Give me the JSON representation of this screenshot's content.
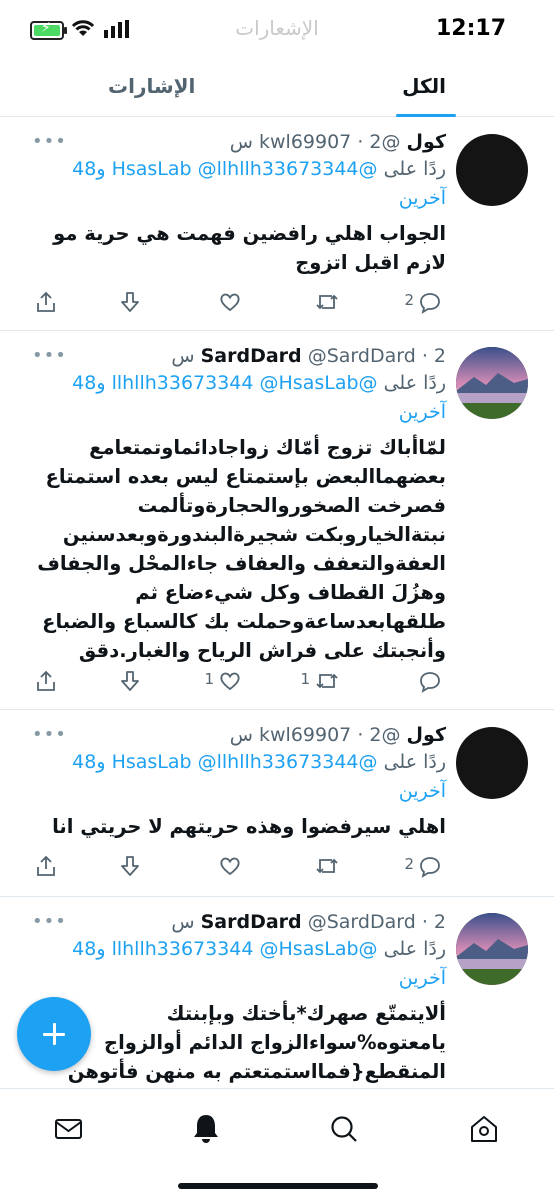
{
  "status": {
    "time": "12:17",
    "faded_title": "الإشعارات"
  },
  "tabs": {
    "all": "الكل",
    "mentions": "الإشارات"
  },
  "tweets": [
    {
      "name": "كول",
      "handle": "@kwl69907",
      "time": "2 س",
      "reply_label": "ردًا على",
      "reply_handles": "@HsasLab @llhllh33673344 و48",
      "reply_more": "آخرين",
      "text": "الجواب اهلي رافضين فهمت هي حرية مو لازم اقبل اتزوج",
      "reply_count": "2",
      "retweet_count": "",
      "like_count": ""
    },
    {
      "name": "SardDard",
      "handle": "@SardDard",
      "time": "2 س",
      "reply_label": "ردًا على",
      "reply_handles": "@llhllh33673344 @HsasLab و48",
      "reply_more": "آخرين",
      "text": "لمّاأباك تزوج أمّاك زواجادائماوتمتعامع بعضهماالبعض بإستمتاع ليس بعده استمتاع فصرخت الصخوروالحجارةوتألمت نبتةالخياروبكت شجيرةالبندورةوبعدسنين العفةوالتعفف والعفاف جاءالمحْل والجفاف وهزُلَ القطاف وكل شيءضاع ثم طلقهابعدساعةوحملت بك كالسباع والضباع وأنجبتك على فراش الرياح والغبار.دقق",
      "reply_count": "",
      "retweet_count": "1",
      "like_count": "1"
    },
    {
      "name": "كول",
      "handle": "@kwl69907",
      "time": "2 س",
      "reply_label": "ردًا على",
      "reply_handles": "@HsasLab @llhllh33673344 و48",
      "reply_more": "آخرين",
      "text": "اهلي سيرفضوا وهذه حريتهم لا حريتي انا",
      "reply_count": "2",
      "retweet_count": "",
      "like_count": ""
    },
    {
      "name": "SardDard",
      "handle": "@SardDard",
      "time": "2 س",
      "reply_label": "ردًا على",
      "reply_handles": "@llhllh33673344 @HsasLab و48",
      "reply_more": "آخرين",
      "text": "ألايتمتّع صهرك*بأختك وبإبنتك يامعتوه%سواءالزواج الدائم أوالزواج المنقطع{فمااستمتعتم به منهن فأتوهن",
      "reply_count": "",
      "retweet_count": "",
      "like_count": ""
    }
  ],
  "icons": {
    "more": "more-icon",
    "share": "share-icon",
    "downvote": "downvote-icon",
    "like": "heart-icon",
    "retweet": "retweet-icon",
    "reply": "reply-icon",
    "compose": "plus-icon",
    "nav": [
      "mail-icon",
      "bell-icon",
      "search-icon",
      "home-icon"
    ]
  },
  "colors": {
    "accent": "#1da1f2",
    "text": "#0f1419",
    "muted": "#536471",
    "divider": "#e1e8ed"
  }
}
